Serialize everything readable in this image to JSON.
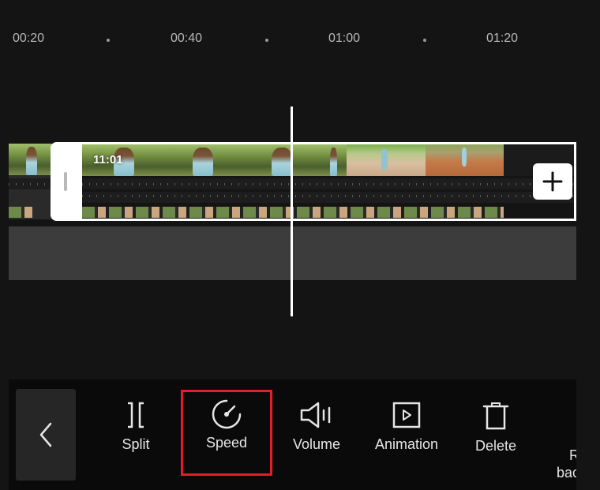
{
  "ruler": {
    "labels": [
      "00:20",
      "00:40",
      "01:00",
      "01:20"
    ]
  },
  "timeline": {
    "clip_duration": "11:01"
  },
  "toolbar": {
    "tools": [
      {
        "label": "Split",
        "icon": "split-icon"
      },
      {
        "label": "Speed",
        "icon": "speedometer-icon",
        "highlighted": true
      },
      {
        "label": "Volume",
        "icon": "speaker-icon"
      },
      {
        "label": "Animation",
        "icon": "play-square-icon"
      },
      {
        "label": "Delete",
        "icon": "trash-icon"
      }
    ],
    "partial_tool_line1": "R",
    "partial_tool_line2": "bac"
  },
  "colors": {
    "background": "#141414",
    "highlight": "#e31f25",
    "toolbar_bg": "#0a0a0a"
  }
}
